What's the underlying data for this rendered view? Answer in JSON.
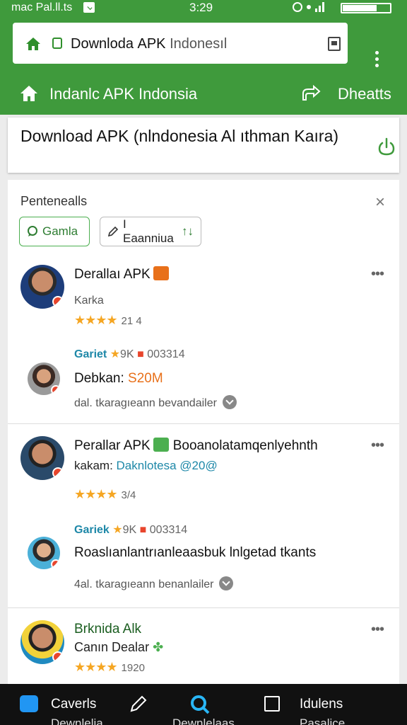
{
  "status_bar": {
    "carrier": "mac Pal.ll.ts",
    "time": "3:29",
    "battery_level": 0.7
  },
  "browser": {
    "url_text": "Downlodа APK",
    "url_domain": "Indonesıl"
  },
  "site_header": {
    "title": "Indanlc APK Indonsia",
    "right_label": "Dheatts"
  },
  "title_card": {
    "headline": "Download APK (nlndonesia Al ıthman Kaıra)"
  },
  "panel": {
    "title": "Pentenealls",
    "chips": [
      {
        "label": "Gamla"
      },
      {
        "label": "I Eaanniua"
      }
    ]
  },
  "items": [
    {
      "name": "Derallaı APK",
      "sub": "Karka",
      "rating_count": "21 4",
      "stat_brand": "Gariet",
      "stat_text": "9K",
      "stat_code": "003314",
      "line2_prefix": "Debkan: ",
      "line2_accent": "S20M",
      "line3": "dal. tkaragıeann bevandailer"
    },
    {
      "name": "Perallar APK",
      "name_suffix": "Booanolatamqenlyehnth",
      "sub_prefix": "kakam:",
      "sub_link": "Daknlotesa @20@",
      "rating_count": "3/4",
      "stat_brand": "Gariek",
      "stat_text": "9K",
      "stat_code": "003314",
      "line2_prefix": "Roaslıanlantrıanleaasbuk lnlgetad tkants",
      "line3": "4al. tkaragıeann benanlailer"
    },
    {
      "name": "Brknida Alk",
      "sub": "Canın Dealar",
      "rating_count": "1920"
    }
  ],
  "bottom_nav": [
    {
      "label": "Caverls",
      "sub": "Dewnlelia"
    },
    {
      "label": "",
      "sub": ""
    },
    {
      "label": "",
      "sub": "Dewnlelaas"
    },
    {
      "label": "",
      "sub": ""
    },
    {
      "label": "Idulens",
      "sub": "Pasalice"
    }
  ],
  "colors": {
    "brand_green": "#3f9a3c",
    "star": "#f5a623",
    "accent_orange": "#e8701a",
    "link_blue": "#1e88a8"
  }
}
